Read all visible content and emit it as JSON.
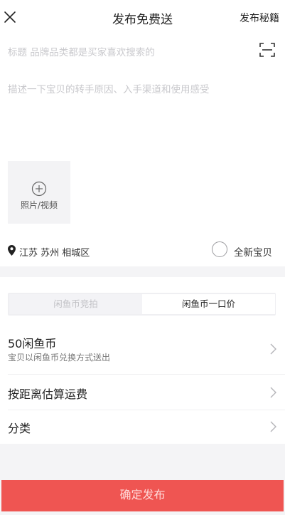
{
  "header": {
    "title": "发布免费送",
    "right_link": "发布秘籍"
  },
  "form": {
    "title_placeholder": "标题 品牌品类都是买家喜欢搜索的",
    "description_placeholder": "描述一下宝贝的转手原因、入手渠道和使用感受",
    "media_label": "照片/视频",
    "location": "江苏 苏州 相城区",
    "new_item_label": "全新宝贝",
    "new_item_checked": false
  },
  "mode_tabs": [
    {
      "label": "闲鱼币竞拍",
      "selected": false
    },
    {
      "label": "闲鱼币一口价",
      "selected": true
    }
  ],
  "rows": {
    "coins_title": "50闲鱼币",
    "coins_subtitle": "宝贝以闲鱼币兑换方式送出",
    "shipping_title": "按距离估算运费",
    "category_title": "分类"
  },
  "footer": {
    "confirm_label": "确定发布"
  },
  "colors": {
    "accent": "#ef5552",
    "placeholder": "#c9c9cd"
  }
}
